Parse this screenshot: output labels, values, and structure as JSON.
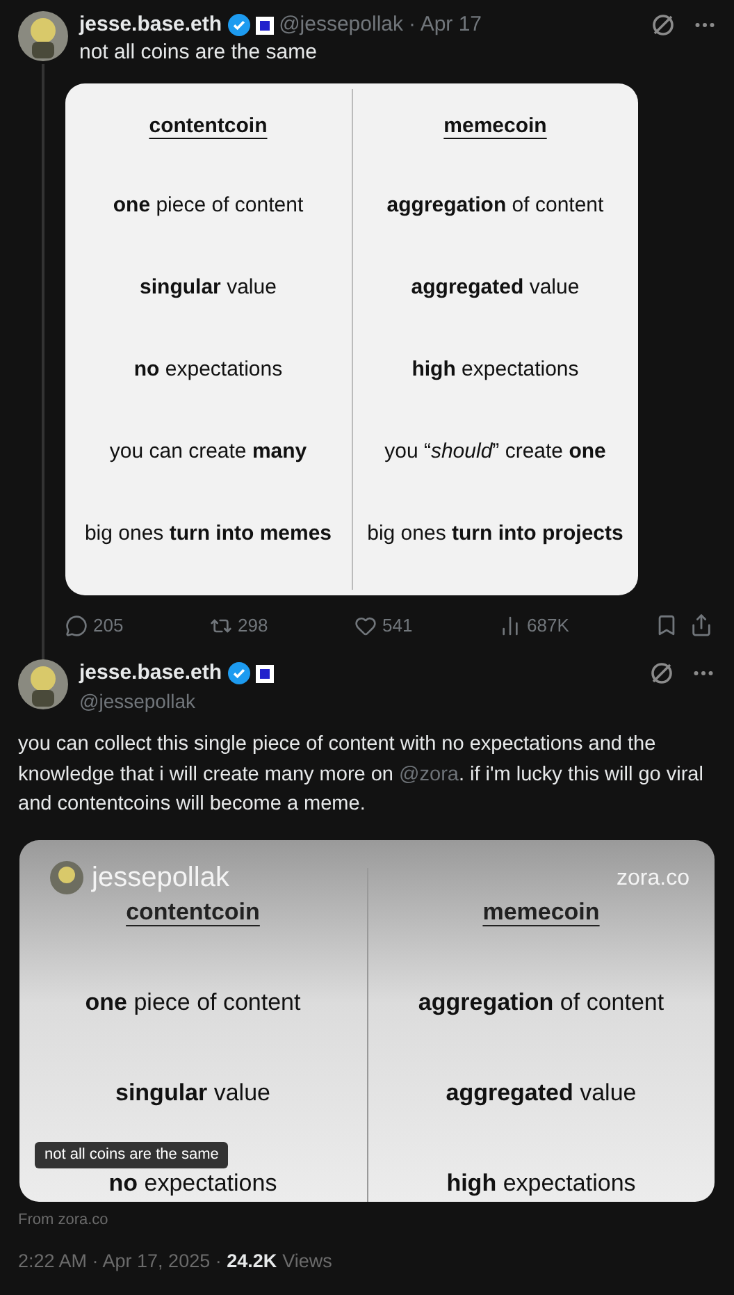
{
  "tweets": [
    {
      "author": {
        "name": "jesse.base.eth",
        "handle": "@jessepollak",
        "date": "· Apr 17"
      },
      "text": "not all coins are the same",
      "card": {
        "columns": [
          {
            "heading": "contentcoin",
            "rows": [
              "**one** piece of content",
              "**singular** value",
              "**no** expectations",
              "you can create **many**",
              "big ones **turn into memes**"
            ]
          },
          {
            "heading": "memecoin",
            "rows": [
              "**aggregation** of content",
              "**aggregated** value",
              "**high** expectations",
              "you “*should*” create **one**",
              "big ones **turn into projects**"
            ]
          }
        ]
      },
      "actions": [
        {
          "kind": "reply",
          "count": "205"
        },
        {
          "kind": "repost",
          "count": "298"
        },
        {
          "kind": "like",
          "count": "541"
        },
        {
          "kind": "views",
          "count": "687K"
        },
        {
          "kind": "bookmark"
        },
        {
          "kind": "share"
        }
      ]
    },
    {
      "author": {
        "name": "jesse.base.eth",
        "handle": "@jessepollak"
      },
      "text_before": "you can collect this single piece of content with no expectations and the knowledge that i will create many more on ",
      "mention": "@zora",
      "text_after": ". if i'm lucky this will go viral and contentcoins will become a meme.",
      "video": {
        "user": "jessepollak",
        "site": "zora.co",
        "caption": "not all coins are the same",
        "columns": [
          {
            "heading": "contentcoin",
            "rows": [
              "**one** piece of content",
              "**singular** value",
              "**no** expectations"
            ]
          },
          {
            "heading": "memecoin",
            "rows": [
              "**aggregation** of content",
              "**aggregated** value",
              "**high** expectations"
            ]
          }
        ]
      },
      "source": "From zora.co",
      "time": "2:22 AM · Apr 17, 2025 · ",
      "views": "24.2K",
      "views_label": "Views"
    }
  ]
}
